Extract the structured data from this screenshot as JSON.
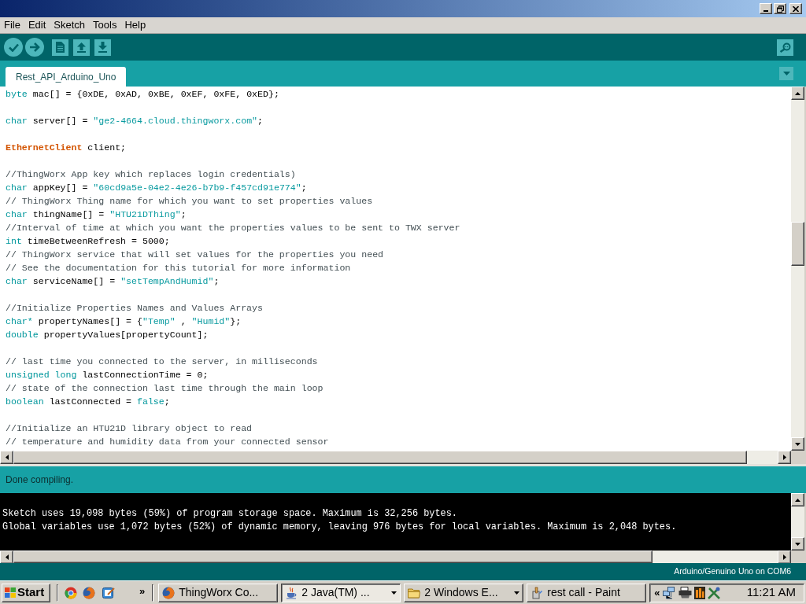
{
  "menu_bar": {
    "items": [
      "File",
      "Edit",
      "Sketch",
      "Tools",
      "Help"
    ]
  },
  "tabs": [
    {
      "label": "Rest_API_Arduino_Uno",
      "selected": true
    }
  ],
  "editor": {
    "lines": [
      {
        "kind": "code",
        "segments": [
          {
            "kind": "type",
            "text": "byte"
          },
          {
            "kind": "plain",
            "text": " mac[] = {0xDE, 0xAD, 0xBE, 0xEF, 0xFE, 0xED};"
          }
        ]
      },
      {
        "kind": "blank"
      },
      {
        "kind": "code",
        "segments": [
          {
            "kind": "type",
            "text": "char"
          },
          {
            "kind": "plain",
            "text": " server[] = "
          },
          {
            "kind": "string",
            "text": "\"ge2-4664.cloud.thingworx.com\""
          },
          {
            "kind": "plain",
            "text": ";"
          }
        ]
      },
      {
        "kind": "blank"
      },
      {
        "kind": "code",
        "segments": [
          {
            "kind": "class",
            "text": "EthernetClient"
          },
          {
            "kind": "plain",
            "text": " client;"
          }
        ]
      },
      {
        "kind": "blank"
      },
      {
        "kind": "code",
        "segments": [
          {
            "kind": "comment",
            "text": "//ThingWorx App key which replaces login credentials)"
          }
        ]
      },
      {
        "kind": "code",
        "segments": [
          {
            "kind": "type",
            "text": "char"
          },
          {
            "kind": "plain",
            "text": " appKey[] = "
          },
          {
            "kind": "string",
            "text": "\"60cd9a5e-04e2-4e26-b7b9-f457cd91e774\""
          },
          {
            "kind": "plain",
            "text": ";"
          }
        ]
      },
      {
        "kind": "code",
        "segments": [
          {
            "kind": "comment",
            "text": "// ThingWorx Thing name for which you want to set properties values"
          }
        ]
      },
      {
        "kind": "code",
        "segments": [
          {
            "kind": "type",
            "text": "char"
          },
          {
            "kind": "plain",
            "text": " thingName[] = "
          },
          {
            "kind": "string",
            "text": "\"HTU21DThing\""
          },
          {
            "kind": "plain",
            "text": ";"
          }
        ]
      },
      {
        "kind": "code",
        "segments": [
          {
            "kind": "comment",
            "text": "//Interval of time at which you want the properties values to be sent to TWX server"
          }
        ]
      },
      {
        "kind": "code",
        "segments": [
          {
            "kind": "type",
            "text": "int"
          },
          {
            "kind": "plain",
            "text": " timeBetweenRefresh = 5000;"
          }
        ]
      },
      {
        "kind": "code",
        "segments": [
          {
            "kind": "comment",
            "text": "// ThingWorx service that will set values for the properties you need"
          }
        ]
      },
      {
        "kind": "code",
        "segments": [
          {
            "kind": "comment",
            "text": "// See the documentation for this tutorial for more information"
          }
        ]
      },
      {
        "kind": "code",
        "segments": [
          {
            "kind": "type",
            "text": "char"
          },
          {
            "kind": "plain",
            "text": " serviceName[] = "
          },
          {
            "kind": "string",
            "text": "\"setTempAndHumid\""
          },
          {
            "kind": "plain",
            "text": ";"
          }
        ]
      },
      {
        "kind": "blank"
      },
      {
        "kind": "code",
        "segments": [
          {
            "kind": "comment",
            "text": "//Initialize Properties Names and Values Arrays"
          }
        ]
      },
      {
        "kind": "code",
        "segments": [
          {
            "kind": "type",
            "text": "char*"
          },
          {
            "kind": "plain",
            "text": " propertyNames[] = {"
          },
          {
            "kind": "string",
            "text": "\"Temp\""
          },
          {
            "kind": "plain",
            "text": " , "
          },
          {
            "kind": "string",
            "text": "\"Humid\""
          },
          {
            "kind": "plain",
            "text": "};"
          }
        ]
      },
      {
        "kind": "code",
        "segments": [
          {
            "kind": "type",
            "text": "double"
          },
          {
            "kind": "plain",
            "text": " propertyValues[propertyCount];"
          }
        ]
      },
      {
        "kind": "blank"
      },
      {
        "kind": "code",
        "segments": [
          {
            "kind": "comment",
            "text": "// last time you connected to the server, in milliseconds"
          }
        ]
      },
      {
        "kind": "code",
        "segments": [
          {
            "kind": "type",
            "text": "unsigned long"
          },
          {
            "kind": "plain",
            "text": " lastConnectionTime = 0;"
          }
        ]
      },
      {
        "kind": "code",
        "segments": [
          {
            "kind": "comment",
            "text": "// state of the connection last time through the main loop"
          }
        ]
      },
      {
        "kind": "code",
        "segments": [
          {
            "kind": "type",
            "text": "boolean"
          },
          {
            "kind": "plain",
            "text": " lastConnected = "
          },
          {
            "kind": "type",
            "text": "false"
          },
          {
            "kind": "plain",
            "text": ";"
          }
        ]
      },
      {
        "kind": "blank"
      },
      {
        "kind": "code",
        "segments": [
          {
            "kind": "comment",
            "text": "//Initialize an HTU21D library object to read"
          }
        ]
      },
      {
        "kind": "code",
        "segments": [
          {
            "kind": "comment",
            "text": "// temperature and humidity data from your connected sensor"
          }
        ]
      }
    ]
  },
  "status": {
    "message": "Done compiling."
  },
  "console": {
    "lines": [
      {
        "kind": "blank"
      },
      {
        "kind": "text",
        "text": "Sketch uses 19,098 bytes (59%) of program storage space. Maximum is 32,256 bytes."
      },
      {
        "kind": "text",
        "text": "Global variables use 1,072 bytes (52%) of dynamic memory, leaving 976 bytes for local variables. Maximum is 2,048 bytes."
      }
    ]
  },
  "board_status": "Arduino/Genuino Uno on COM6",
  "taskbar": {
    "start": "Start",
    "quick_launch_more": "»",
    "tasks": [
      {
        "kind": "browser",
        "label": "ThingWorx Co...",
        "selected": false,
        "grouped": false
      },
      {
        "kind": "java",
        "label": "2 Java(TM) ...",
        "selected": true,
        "grouped": true
      },
      {
        "kind": "folder",
        "label": "2 Windows E...",
        "selected": false,
        "grouped": true
      },
      {
        "kind": "paint",
        "label": "rest call - Paint",
        "selected": false,
        "grouped": false
      }
    ],
    "tray_toggle": "«",
    "clock": "11:21 AM"
  }
}
